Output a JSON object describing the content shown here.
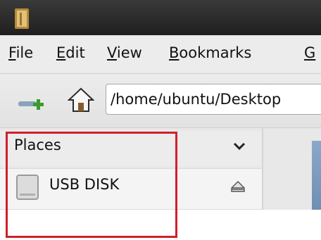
{
  "menu": {
    "items": [
      {
        "mnemonic": "F",
        "rest": "ile"
      },
      {
        "mnemonic": "E",
        "rest": "dit"
      },
      {
        "mnemonic": "V",
        "rest": "iew"
      },
      {
        "mnemonic": "B",
        "rest": "ookmarks"
      },
      {
        "mnemonic": "G",
        "rest": ""
      }
    ]
  },
  "toolbar": {
    "location_value": "/home/ubuntu/Desktop"
  },
  "sidebar": {
    "header_label": "Places",
    "items": [
      {
        "label": "USB DISK",
        "icon": "drive-icon",
        "action_icon": "eject-icon"
      }
    ]
  },
  "annotation": {
    "color": "#d0202a"
  }
}
